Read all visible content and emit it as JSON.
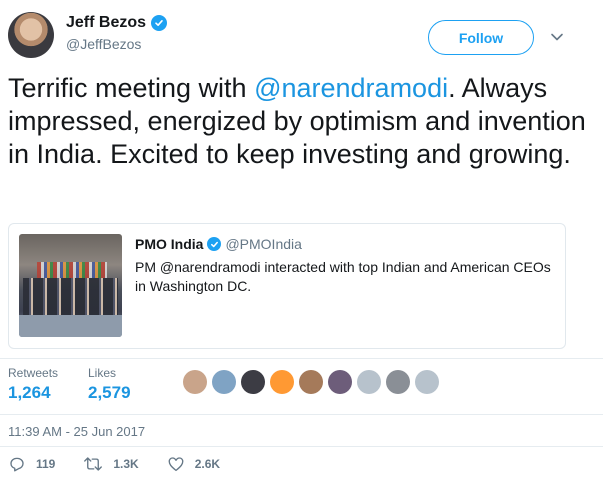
{
  "author": {
    "name": "Jeff Bezos",
    "handle": "@JeffBezos",
    "verified": true
  },
  "follow_label": "Follow",
  "tweet": {
    "text_before": "Terrific meeting with ",
    "mention": "@narendramodi",
    "text_after": ". Always impressed, energized by optimism and invention in India. Excited to keep investing and growing."
  },
  "quote": {
    "name": "PMO India",
    "handle": "@PMOIndia",
    "text": "PM @narendramodi interacted with top Indian and American CEOs in Washington DC."
  },
  "stats": {
    "retweets_label": "Retweets",
    "retweets_value": "1,264",
    "likes_label": "Likes",
    "likes_value": "2,579"
  },
  "likers_count": 9,
  "timestamp": "11:39 AM - 25 Jun 2017",
  "actions": {
    "replies": "119",
    "retweets": "1.3K",
    "likes": "2.6K"
  },
  "colors": {
    "accent": "#1da1f2",
    "link": "#1b95e0",
    "muted": "#657786"
  },
  "icons": [
    "verified-badge-icon",
    "chevron-down-icon",
    "reply-icon",
    "retweet-icon",
    "heart-icon"
  ]
}
